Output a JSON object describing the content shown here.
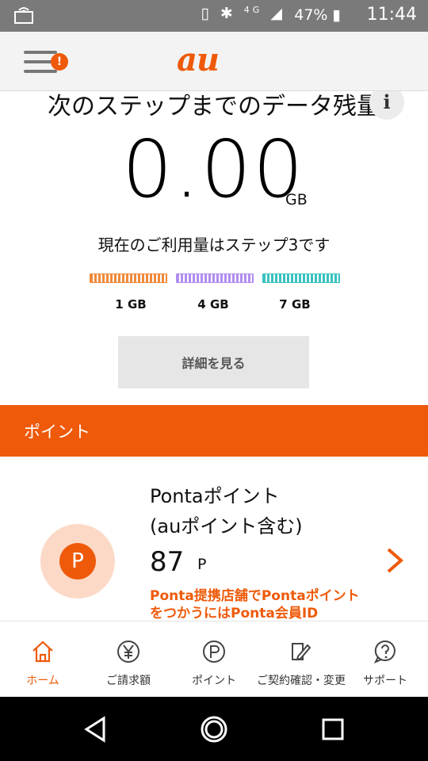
{
  "status_bar": {
    "battery": "47%",
    "time": "11:44",
    "network": "4G",
    "icons": [
      "screen-cast-icon",
      "nfc-icon",
      "bluetooth-icon",
      "signal-icon",
      "battery-icon"
    ]
  },
  "app_bar": {
    "logo": "au",
    "menu_badge": "!",
    "icons": [
      "hamburger-menu-icon"
    ]
  },
  "data_usage": {
    "title": "次のステップまでのデータ残量",
    "info_label": "i",
    "remaining": "0.00",
    "unit": "GB",
    "step_text": "現在のご利用量はステップ3です",
    "steps": [
      {
        "label": "1 GB"
      },
      {
        "label": "4 GB"
      },
      {
        "label": "7 GB"
      }
    ],
    "detail_button": "詳細を見る"
  },
  "points_section": {
    "header": "ポイント",
    "icon_letter": "P",
    "title_line1": "Pontaポイント",
    "title_line2": "(auポイント含む)",
    "value": "87",
    "unit": "P",
    "note": "Ponta提携店舗でPontaポイントをつかうにはPonta会員ID"
  },
  "tab_bar": {
    "tabs": [
      {
        "label": "ホーム",
        "icon": "home-icon",
        "active": true
      },
      {
        "label": "ご請求額",
        "icon": "yen-icon",
        "active": false
      },
      {
        "label": "ポイント",
        "icon": "point-icon",
        "active": false
      },
      {
        "label": "ご契約確認・変更",
        "icon": "contract-edit-icon",
        "active": false
      },
      {
        "label": "サポート",
        "icon": "help-icon",
        "active": false
      }
    ]
  },
  "colors": {
    "accent": "#ee5a0a",
    "status_bar": "#7a7a7a",
    "step_colors": [
      "#f0893a",
      "#b18cf0",
      "#38c2c0"
    ]
  }
}
